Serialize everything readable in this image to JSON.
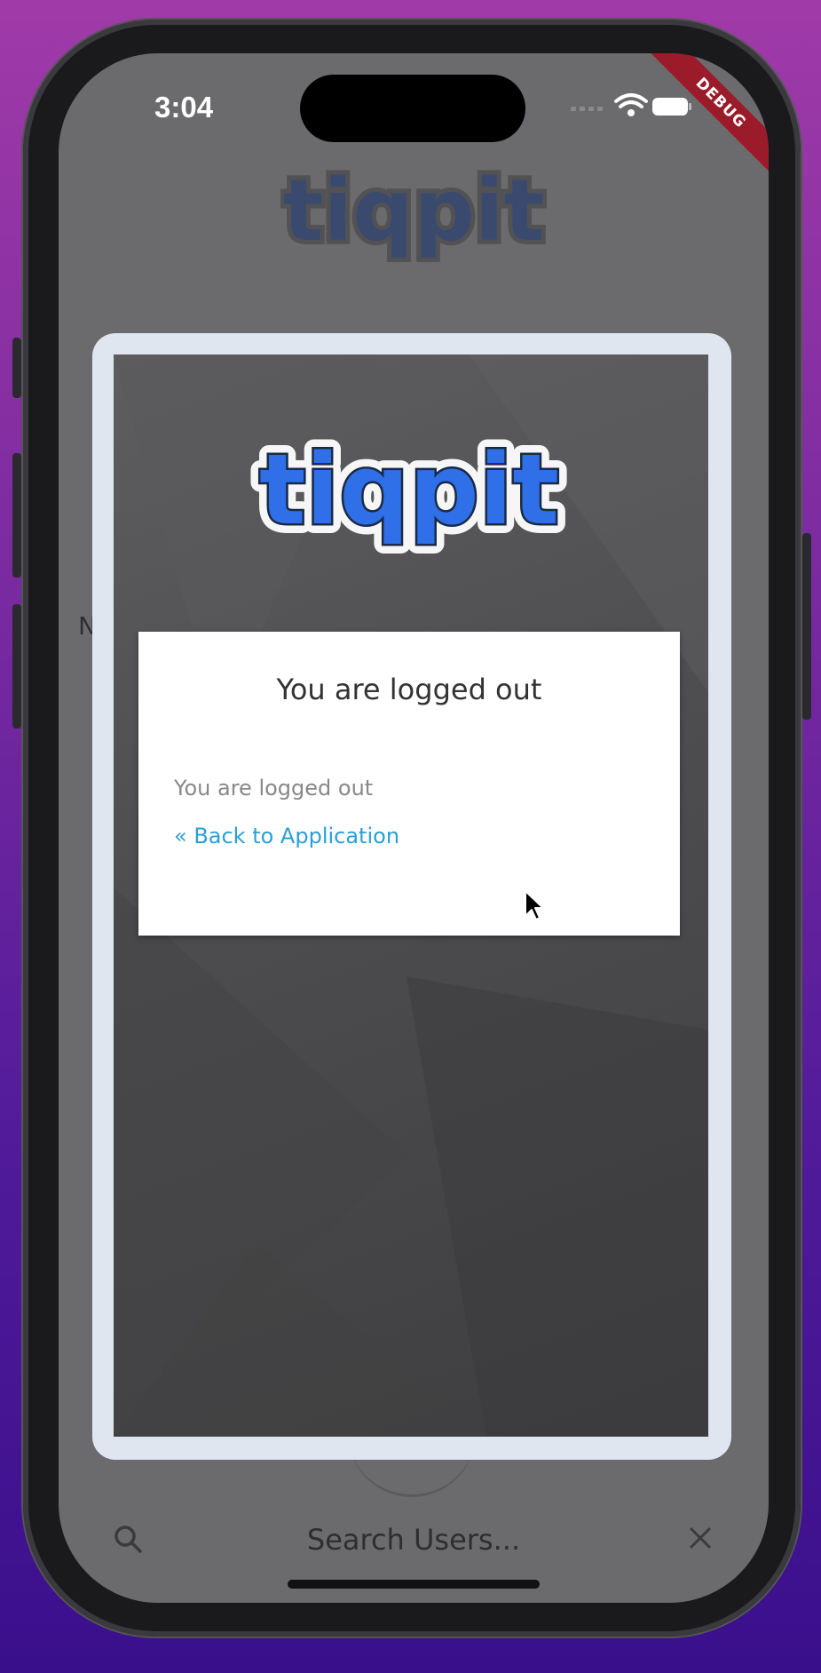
{
  "status_bar": {
    "time": "3:04"
  },
  "debug_banner": "DEBUG",
  "background_app": {
    "logo_text": "tiqpit",
    "partial_label": "N",
    "search": {
      "placeholder": "Search Users..."
    }
  },
  "auth_webview": {
    "logo_text": "tiqpit",
    "card": {
      "title": "You are logged out",
      "message": "You are logged out",
      "back_link": "« Back to Application"
    }
  },
  "colors": {
    "logo_blue": "#2f6fe8",
    "link_blue": "#2a9fd6",
    "debug_red": "#9b1b2a"
  }
}
